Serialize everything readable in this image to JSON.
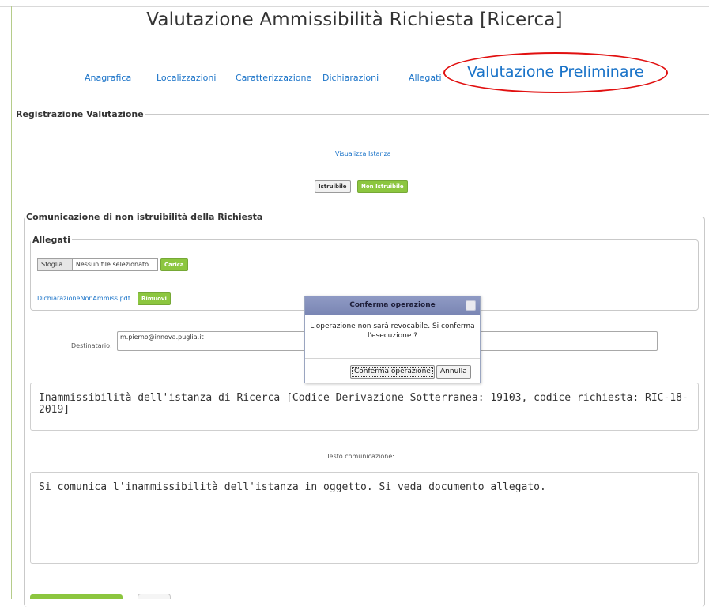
{
  "page": {
    "title": "Valutazione Ammissibilità Richiesta [Ricerca]"
  },
  "nav": {
    "tabs": [
      {
        "label": "Anagrafica"
      },
      {
        "label": "Localizzazioni"
      },
      {
        "label": "Caratterizzazione"
      },
      {
        "label": "Dichiarazioni"
      },
      {
        "label": "Allegati"
      },
      {
        "label": "Valutazione Preliminare"
      }
    ],
    "active_tab": "Valutazione Preliminare"
  },
  "registrazione": {
    "legend": "Registrazione Valutazione",
    "view_link": "Visualizza Istanza",
    "btn_istruibile": "Istruibile",
    "btn_non_istruibile": "Non Istruibile"
  },
  "comunicazione": {
    "legend": "Comunicazione di non istruibilità della Richiesta",
    "allegati": {
      "legend": "Allegati",
      "browse_label": "Sfoglia...",
      "no_file_text": "Nessun file selezionato.",
      "upload_button": "Carica",
      "file_name": "DichiarazioneNonAmmiss.pdf",
      "remove_button": "Rimuovi"
    },
    "destinatario_label": "Destinatario:",
    "destinatario_value": "m.pierno@innova.puglia.it",
    "oggetto": "Inammissibilità dell'istanza di Ricerca [Codice Derivazione Sotterranea: 19103, codice richiesta: RIC-18-2019]",
    "testo_label": "Testo comunicazione:",
    "testo": "Si comunica l'inammissibilità dell'istanza in oggetto. Si veda documento allegato."
  },
  "dialog": {
    "title": "Conferma operazione",
    "message": "L'operazione non sarà revocabile. Si conferma l'esecuzione ?",
    "confirm_button": "Conferma operazione",
    "cancel_button": "Annulla"
  },
  "colors": {
    "link": "#1a73c8",
    "accent_green": "#8cc63f",
    "highlight_red": "#e11010",
    "dialog_titlebar": "#8f9ac4"
  }
}
